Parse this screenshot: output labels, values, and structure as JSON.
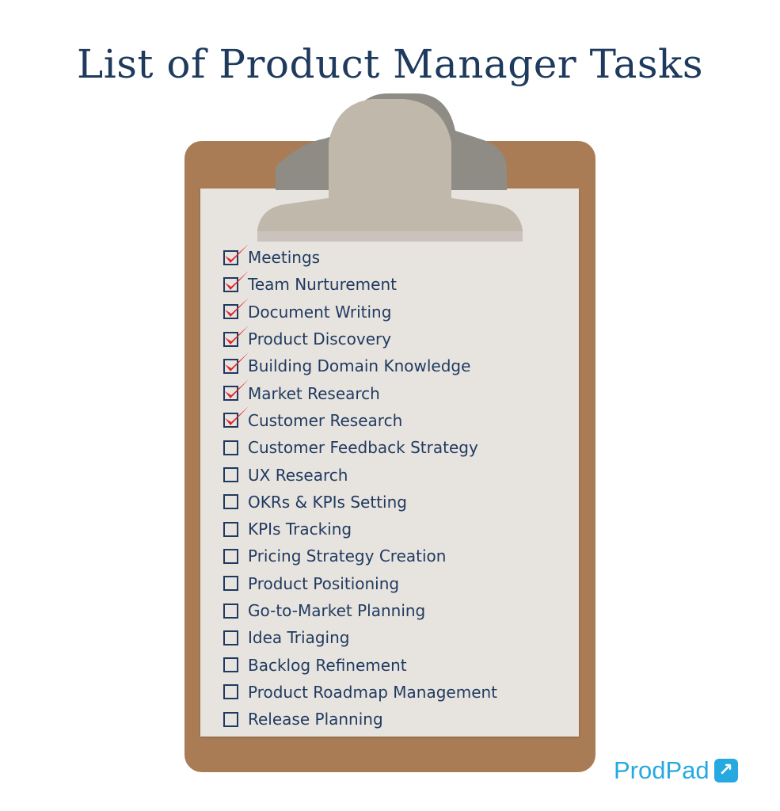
{
  "title": "List of Product Manager Tasks",
  "tasks": [
    {
      "label": "Meetings",
      "checked": true
    },
    {
      "label": "Team Nurturement",
      "checked": true
    },
    {
      "label": "Document Writing",
      "checked": true
    },
    {
      "label": "Product Discovery",
      "checked": true
    },
    {
      "label": "Building Domain Knowledge",
      "checked": true
    },
    {
      "label": "Market Research",
      "checked": true
    },
    {
      "label": "Customer Research",
      "checked": true
    },
    {
      "label": "Customer Feedback Strategy",
      "checked": false
    },
    {
      "label": "UX Research",
      "checked": false
    },
    {
      "label": "OKRs & KPIs Setting",
      "checked": false
    },
    {
      "label": "KPIs Tracking",
      "checked": false
    },
    {
      "label": "Pricing Strategy Creation",
      "checked": false
    },
    {
      "label": "Product Positioning",
      "checked": false
    },
    {
      "label": "Go-to-Market Planning",
      "checked": false
    },
    {
      "label": "Idea Triaging",
      "checked": false
    },
    {
      "label": "Backlog Refinement",
      "checked": false
    },
    {
      "label": "Product Roadmap Management",
      "checked": false
    },
    {
      "label": "Release Planning",
      "checked": false
    }
  ],
  "logo": {
    "text": "ProdPad",
    "icon": "arrow-up-right-icon"
  },
  "colors": {
    "text": "#1f3a5f",
    "check": "#e0262b",
    "board": "#a97c55",
    "paper": "#e7e3df",
    "brand": "#26a9e0"
  }
}
